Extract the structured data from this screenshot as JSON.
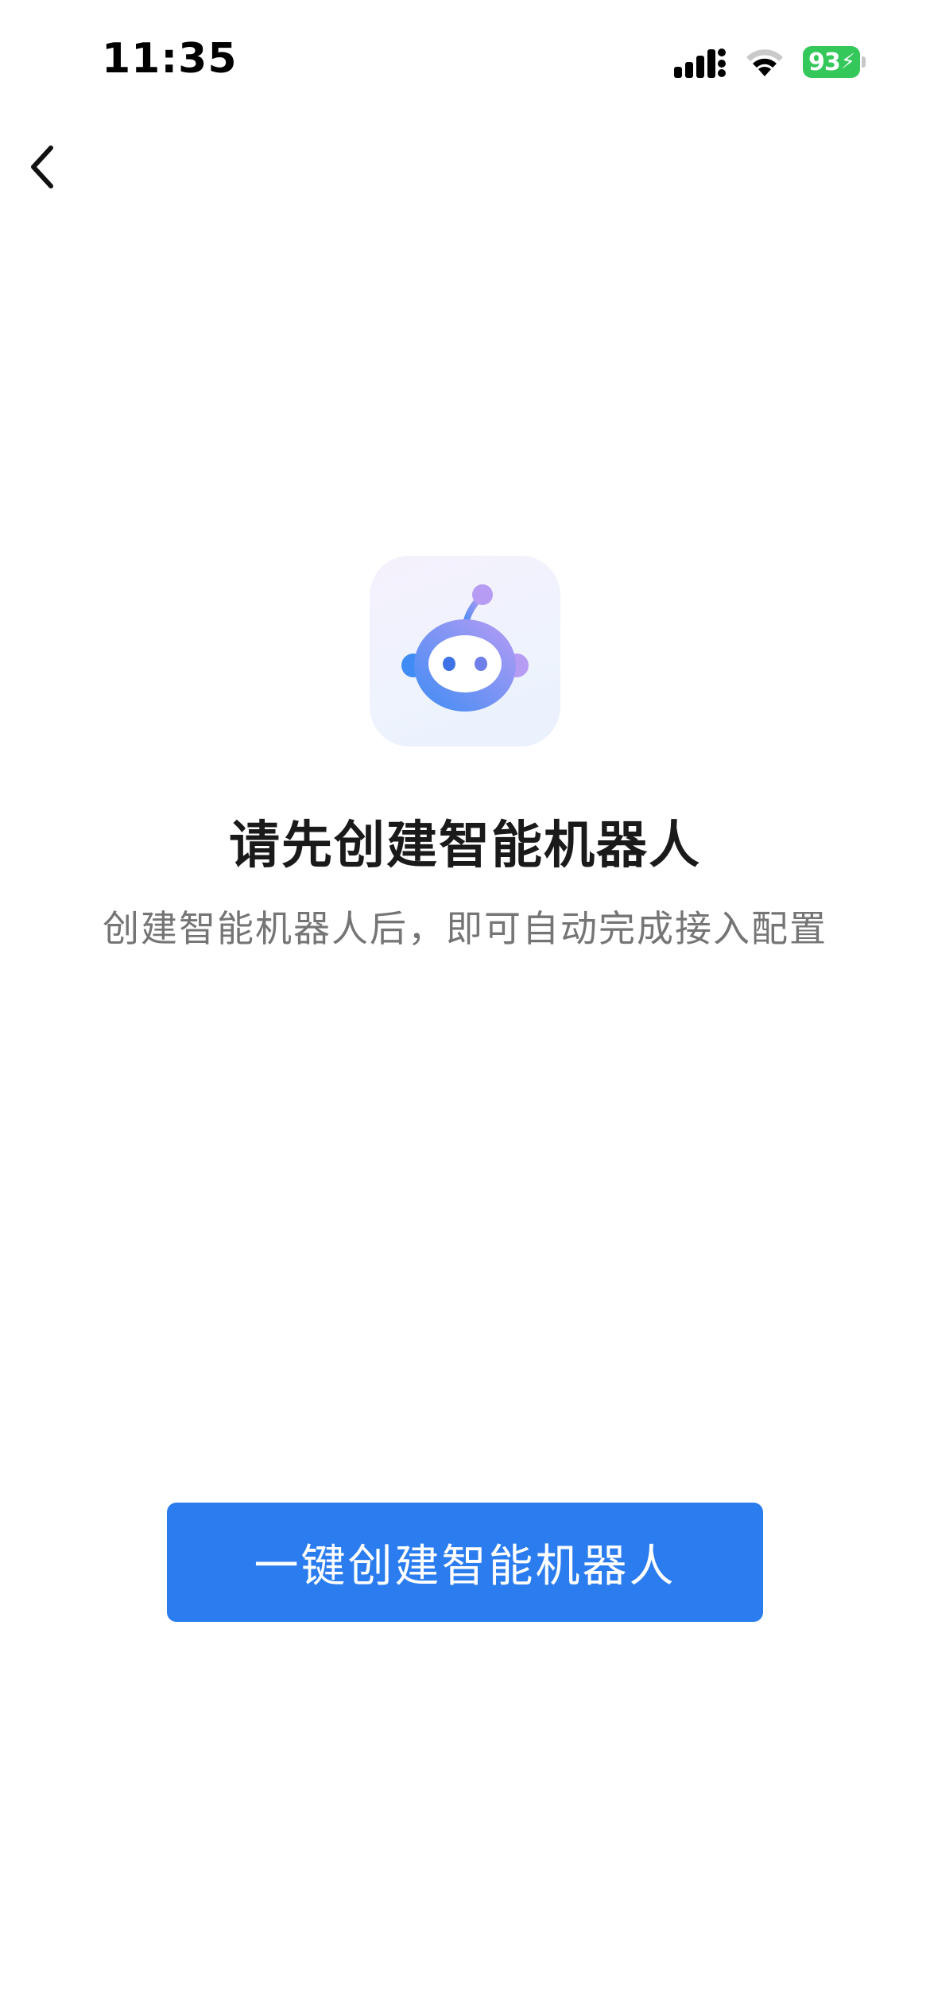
{
  "status_bar": {
    "time": "11:35",
    "battery_level": "93",
    "battery_color": "#34c759",
    "icons": [
      "signal-icon",
      "wifi-icon",
      "battery-icon",
      "charging-bolt-icon"
    ]
  },
  "nav": {
    "back_icon": "chevron-left-icon"
  },
  "illustration": {
    "icon": "robot-icon",
    "gradient_start": "#3f8cf5",
    "gradient_end": "#b79cf3"
  },
  "content": {
    "title": "请先创建智能机器人",
    "subtitle": "创建智能机器人后，即可自动完成接入配置"
  },
  "actions": {
    "create_button_label": "一键创建智能机器人",
    "button_color": "#2b7cef"
  }
}
